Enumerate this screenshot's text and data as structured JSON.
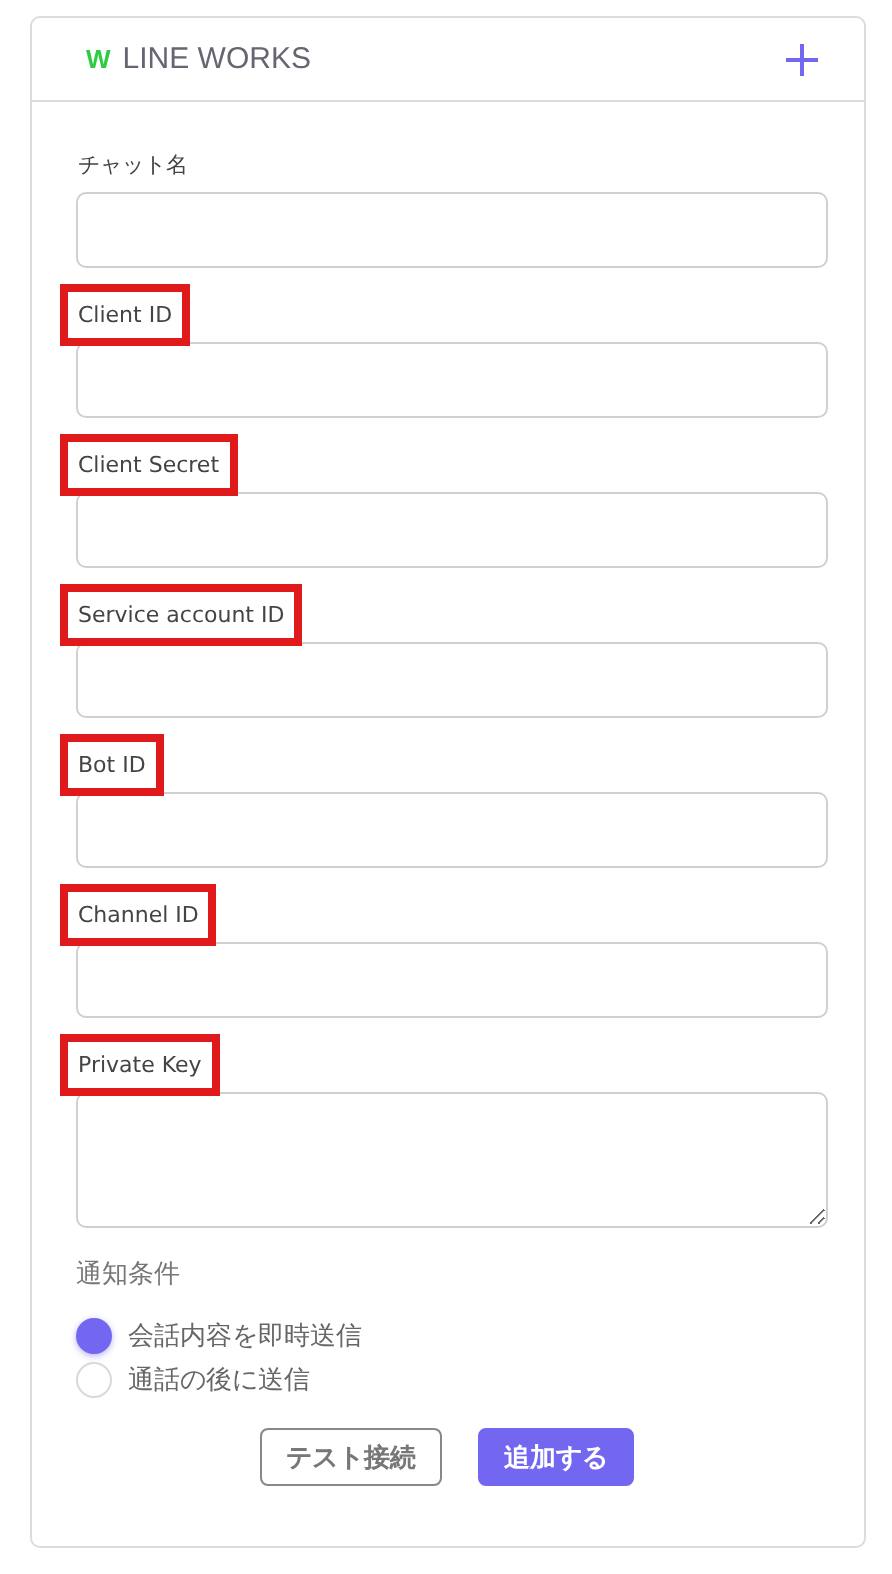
{
  "header": {
    "logo": "W",
    "title": "LINE WORKS"
  },
  "fields": [
    {
      "label": "チャット名",
      "kind": "input",
      "highlighted": false
    },
    {
      "label": "Client ID",
      "kind": "input",
      "highlighted": true
    },
    {
      "label": "Client Secret",
      "kind": "input",
      "highlighted": true
    },
    {
      "label": "Service account ID",
      "kind": "input",
      "highlighted": true
    },
    {
      "label": "Bot ID",
      "kind": "input",
      "highlighted": true
    },
    {
      "label": "Channel ID",
      "kind": "input",
      "highlighted": true
    },
    {
      "label": "Private Key",
      "kind": "textarea",
      "highlighted": true
    }
  ],
  "notify": {
    "label": "通知条件",
    "options": [
      {
        "label": "会話内容を即時送信",
        "selected": true
      },
      {
        "label": "通話の後に送信",
        "selected": false
      }
    ]
  },
  "buttons": [
    {
      "label": "テスト接続",
      "kind": "secondary"
    },
    {
      "label": "追加する",
      "kind": "primary"
    }
  ]
}
